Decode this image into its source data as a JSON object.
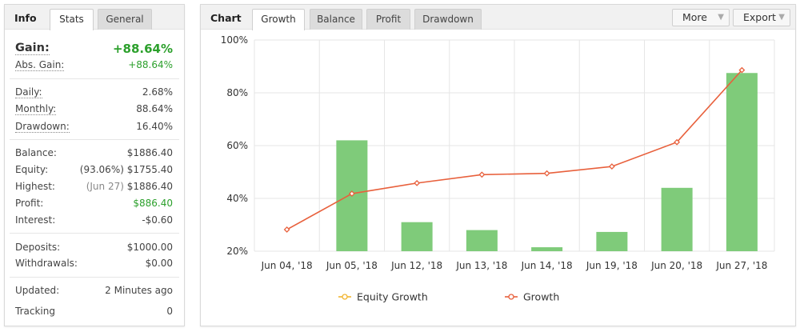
{
  "info_panel": {
    "tabs": [
      {
        "label": "Info",
        "active": false
      },
      {
        "label": "Stats",
        "active": true
      },
      {
        "label": "General",
        "active": false
      }
    ],
    "gain": {
      "label": "Gain:",
      "value": "+88.64%"
    },
    "abs_gain": {
      "label": "Abs. Gain:",
      "value": "+88.64%"
    },
    "daily": {
      "label": "Daily:",
      "value": "2.68%"
    },
    "monthly": {
      "label": "Monthly:",
      "value": "88.64%"
    },
    "drawdown": {
      "label": "Drawdown:",
      "value": "16.40%"
    },
    "balance": {
      "label": "Balance:",
      "value": "$1886.40"
    },
    "equity": {
      "label": "Equity:",
      "prefix": "(93.06%)",
      "value": "$1755.40"
    },
    "highest": {
      "label": "Highest:",
      "prefix": "(Jun 27)",
      "value": "$1886.40"
    },
    "profit": {
      "label": "Profit:",
      "value": "$886.40"
    },
    "interest": {
      "label": "Interest:",
      "value": "-$0.60"
    },
    "deposits": {
      "label": "Deposits:",
      "value": "$1000.00"
    },
    "withdrawals": {
      "label": "Withdrawals:",
      "value": "$0.00"
    },
    "updated": {
      "label": "Updated:",
      "value": "2 Minutes ago"
    },
    "tracking": {
      "label": "Tracking",
      "value": "0"
    }
  },
  "chart_panel": {
    "title": "Chart",
    "tabs": [
      {
        "label": "Growth",
        "active": true
      },
      {
        "label": "Balance",
        "active": false
      },
      {
        "label": "Profit",
        "active": false
      },
      {
        "label": "Drawdown",
        "active": false
      }
    ],
    "more_label": "More",
    "export_label": "Export"
  },
  "colors": {
    "bar": "#7fcb7a",
    "growth_line": "#e8603c",
    "equity_line": "#f2b530",
    "grid": "#e6e6e6",
    "positive": "#2ca02c"
  },
  "chart_data": {
    "type": "bar",
    "categories": [
      "Jun 04, '18",
      "Jun 05, '18",
      "Jun 12, '18",
      "Jun 13, '18",
      "Jun 14, '18",
      "Jun 19, '18",
      "Jun 20, '18",
      "Jun 27, '18"
    ],
    "series": [
      {
        "name": "Equity Growth",
        "type": "bar",
        "values": [
          null,
          62,
          31,
          28,
          21.5,
          27.3,
          44,
          87.5
        ]
      },
      {
        "name": "Growth",
        "type": "line",
        "values": [
          28.2,
          41.8,
          45.8,
          49.0,
          49.5,
          52.1,
          61.3,
          88.6
        ]
      }
    ],
    "ylim": [
      20,
      100
    ],
    "yticks": [
      20,
      40,
      60,
      80,
      100
    ],
    "ytick_labels": [
      "20%",
      "40%",
      "60%",
      "80%",
      "100%"
    ],
    "grid": true,
    "legend": "bottom"
  }
}
